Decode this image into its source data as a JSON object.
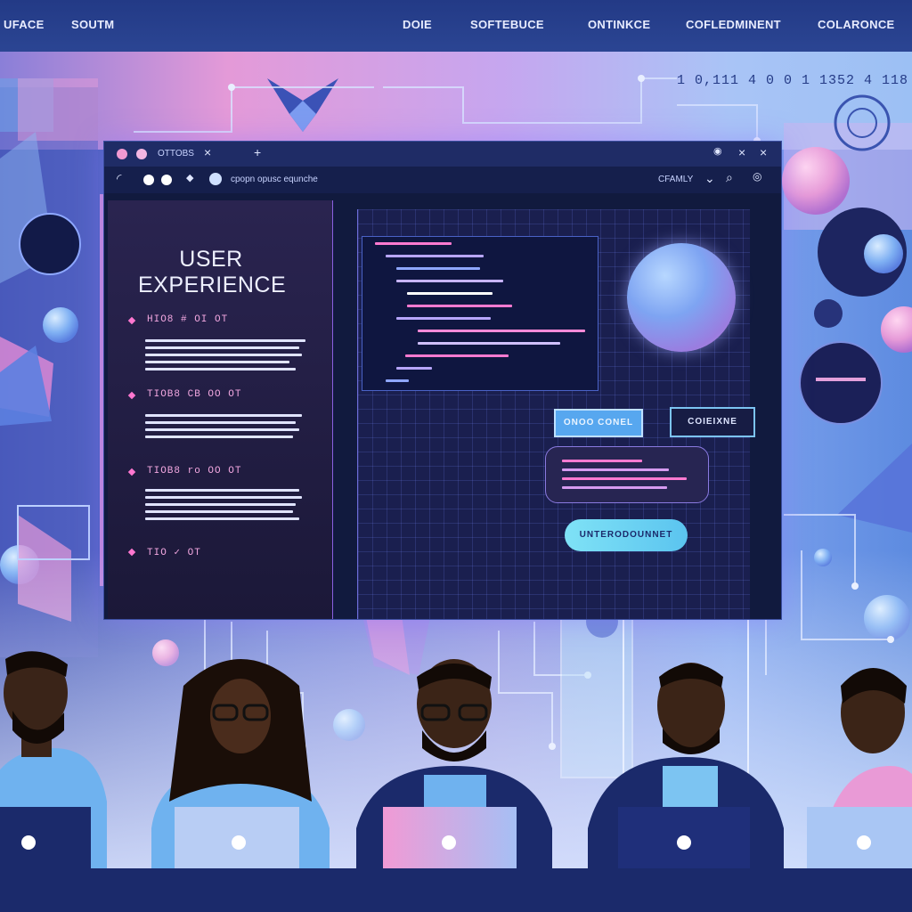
{
  "topnav": {
    "items": [
      "UFACE",
      "SOUTM",
      "DOIE",
      "SOFTEBUCE",
      "ONTINKCE",
      "COFLEDMINENT",
      "COLARONCE"
    ]
  },
  "background": {
    "binary_text": "1 0,111 4 0 0 1 1352 4 118"
  },
  "window": {
    "tab_label": "OTTOBS",
    "address": "cpopn opusc equnche",
    "toolbar_right": "CFAMLY",
    "left_panel": {
      "title": "USER\nEXPERIENCE",
      "sections": [
        "HIO8 # OI OT",
        "TIOB8 CB OO OT",
        "TIOB8 ro OO OT",
        "TIO ✓ OT"
      ]
    },
    "workspace": {
      "primary_button": "ONOO CONEL",
      "secondary_button": "COIEIXNE",
      "cta_button": "UNTERODOUNNET"
    }
  },
  "colors": {
    "nav_bg": "#233a86",
    "accent_pink": "#f2a7e0",
    "accent_cyan": "#7fe2f6",
    "window_bg": "#111a3e"
  }
}
